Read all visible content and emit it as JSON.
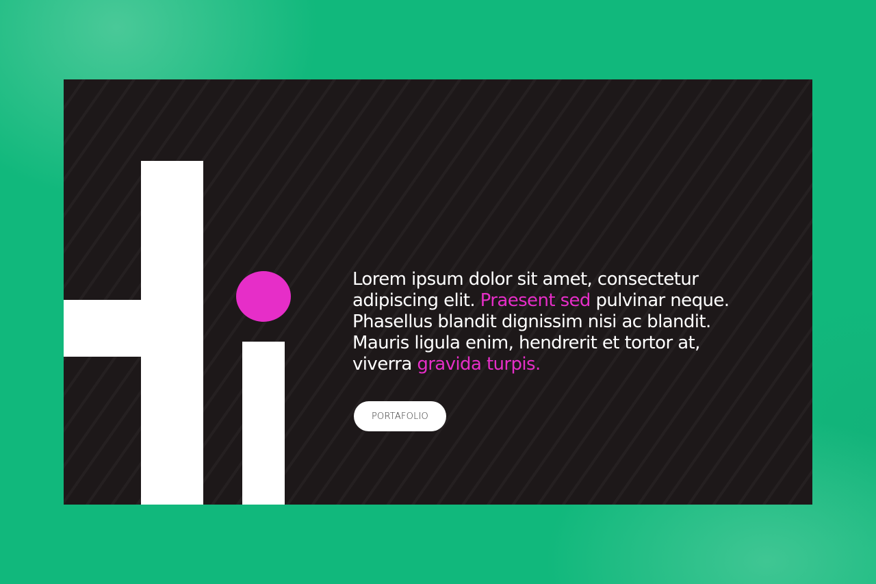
{
  "colors": {
    "page_background": "#11b87c",
    "slide_background": "#1d1819",
    "letters": "#ffffff",
    "accent": "#e62ec8",
    "text": "#ffffff",
    "button_background": "#ffffff",
    "button_text": "#2a2a2a"
  },
  "hero": {
    "title": "Hi",
    "body_lines": [
      [
        {
          "text": "Lorem ipsum dolor sit amet, consectetur",
          "highlight": false
        }
      ],
      [
        {
          "text": "adipiscing elit. ",
          "highlight": false
        },
        {
          "text": "Praesent sed",
          "highlight": true
        },
        {
          "text": " pulvinar neque.",
          "highlight": false
        }
      ],
      [
        {
          "text": "Phasellus blandit dignissim nisi ac blandit.",
          "highlight": false
        }
      ],
      [
        {
          "text": "Mauris ligula enim, hendrerit et tortor at,",
          "highlight": false
        }
      ],
      [
        {
          "text": "viverra ",
          "highlight": false
        },
        {
          "text": "gravida turpis.",
          "highlight": true
        }
      ]
    ],
    "button_label": "PORTAFOLIO"
  }
}
